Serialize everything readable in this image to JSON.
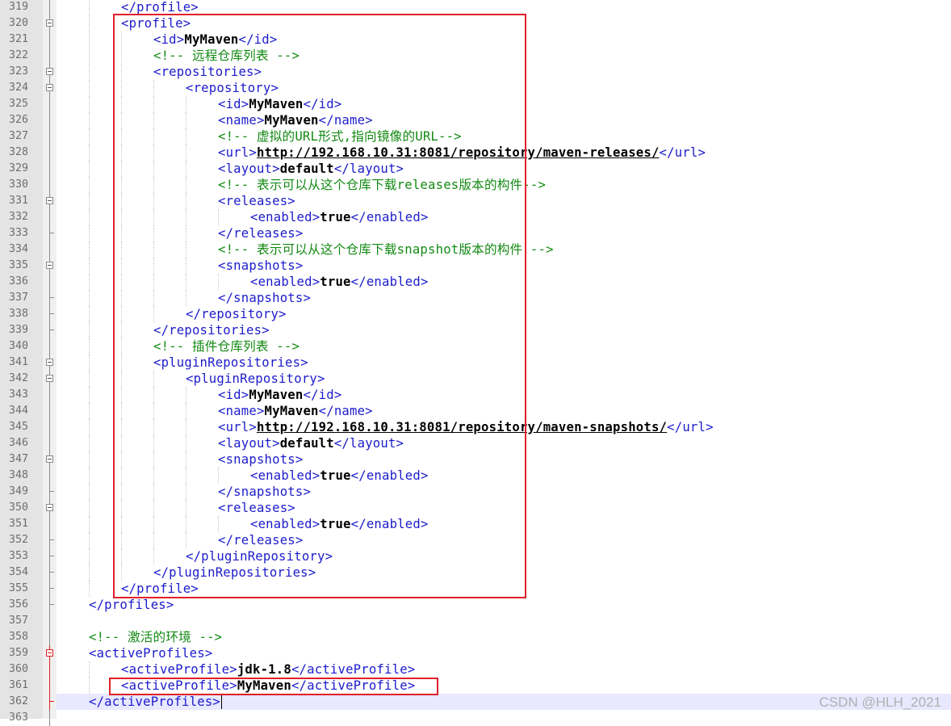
{
  "editor": {
    "current_line": 362,
    "lines": [
      {
        "n": "319",
        "indent": 2,
        "fold": "line",
        "parts": [
          {
            "t": "tag",
            "v": "</profile>"
          }
        ]
      },
      {
        "n": "320",
        "indent": 2,
        "fold": "box",
        "parts": [
          {
            "t": "tag",
            "v": "<profile>"
          }
        ]
      },
      {
        "n": "321",
        "indent": 3,
        "fold": "line",
        "parts": [
          {
            "t": "tag",
            "v": "<id>"
          },
          {
            "t": "text",
            "v": "MyMaven"
          },
          {
            "t": "tag",
            "v": "</id>"
          }
        ]
      },
      {
        "n": "322",
        "indent": 3,
        "fold": "line",
        "parts": [
          {
            "t": "comment",
            "v": "<!-- 远程仓库列表 -->"
          }
        ]
      },
      {
        "n": "323",
        "indent": 3,
        "fold": "box",
        "parts": [
          {
            "t": "tag",
            "v": "<repositories>"
          }
        ]
      },
      {
        "n": "324",
        "indent": 4,
        "fold": "box",
        "parts": [
          {
            "t": "tag",
            "v": "<repository>"
          }
        ]
      },
      {
        "n": "325",
        "indent": 5,
        "fold": "line",
        "parts": [
          {
            "t": "tag",
            "v": "<id>"
          },
          {
            "t": "text",
            "v": "MyMaven"
          },
          {
            "t": "tag",
            "v": "</id>"
          }
        ]
      },
      {
        "n": "326",
        "indent": 5,
        "fold": "line",
        "parts": [
          {
            "t": "tag",
            "v": "<name>"
          },
          {
            "t": "text",
            "v": "MyMaven"
          },
          {
            "t": "tag",
            "v": "</name>"
          }
        ]
      },
      {
        "n": "327",
        "indent": 5,
        "fold": "line",
        "parts": [
          {
            "t": "comment",
            "v": "<!-- 虚拟的URL形式,指向镜像的URL-->"
          }
        ]
      },
      {
        "n": "328",
        "indent": 5,
        "fold": "line",
        "parts": [
          {
            "t": "tag",
            "v": "<url>"
          },
          {
            "t": "url",
            "v": "http://192.168.10.31:8081/repository/maven-releases/"
          },
          {
            "t": "tag",
            "v": "</url>"
          }
        ]
      },
      {
        "n": "329",
        "indent": 5,
        "fold": "line",
        "parts": [
          {
            "t": "tag",
            "v": "<layout>"
          },
          {
            "t": "text",
            "v": "default"
          },
          {
            "t": "tag",
            "v": "</layout>"
          }
        ]
      },
      {
        "n": "330",
        "indent": 5,
        "fold": "line",
        "parts": [
          {
            "t": "comment",
            "v": "<!-- 表示可以从这个仓库下载releases版本的构件-->"
          }
        ]
      },
      {
        "n": "331",
        "indent": 5,
        "fold": "box",
        "parts": [
          {
            "t": "tag",
            "v": "<releases>"
          }
        ]
      },
      {
        "n": "332",
        "indent": 6,
        "fold": "line",
        "parts": [
          {
            "t": "tag",
            "v": "<enabled>"
          },
          {
            "t": "text",
            "v": "true"
          },
          {
            "t": "tag",
            "v": "</enabled>"
          }
        ]
      },
      {
        "n": "333",
        "indent": 5,
        "fold": "end",
        "parts": [
          {
            "t": "tag",
            "v": "</releases>"
          }
        ]
      },
      {
        "n": "334",
        "indent": 5,
        "fold": "line",
        "parts": [
          {
            "t": "comment",
            "v": "<!-- 表示可以从这个仓库下载snapshot版本的构件 -->"
          }
        ]
      },
      {
        "n": "335",
        "indent": 5,
        "fold": "box",
        "parts": [
          {
            "t": "tag",
            "v": "<snapshots>"
          }
        ]
      },
      {
        "n": "336",
        "indent": 6,
        "fold": "line",
        "parts": [
          {
            "t": "tag",
            "v": "<enabled>"
          },
          {
            "t": "text",
            "v": "true"
          },
          {
            "t": "tag",
            "v": "</enabled>"
          }
        ]
      },
      {
        "n": "337",
        "indent": 5,
        "fold": "end",
        "parts": [
          {
            "t": "tag",
            "v": "</snapshots>"
          }
        ]
      },
      {
        "n": "338",
        "indent": 4,
        "fold": "end",
        "parts": [
          {
            "t": "tag",
            "v": "</repository>"
          }
        ]
      },
      {
        "n": "339",
        "indent": 3,
        "fold": "end",
        "parts": [
          {
            "t": "tag",
            "v": "</repositories>"
          }
        ]
      },
      {
        "n": "340",
        "indent": 3,
        "fold": "line",
        "parts": [
          {
            "t": "comment",
            "v": "<!-- 插件仓库列表 -->"
          }
        ]
      },
      {
        "n": "341",
        "indent": 3,
        "fold": "box",
        "parts": [
          {
            "t": "tag",
            "v": "<pluginRepositories>"
          }
        ]
      },
      {
        "n": "342",
        "indent": 4,
        "fold": "box",
        "parts": [
          {
            "t": "tag",
            "v": "<pluginRepository>"
          }
        ]
      },
      {
        "n": "343",
        "indent": 5,
        "fold": "line",
        "parts": [
          {
            "t": "tag",
            "v": "<id>"
          },
          {
            "t": "text",
            "v": "MyMaven"
          },
          {
            "t": "tag",
            "v": "</id>"
          }
        ]
      },
      {
        "n": "344",
        "indent": 5,
        "fold": "line",
        "parts": [
          {
            "t": "tag",
            "v": "<name>"
          },
          {
            "t": "text",
            "v": "MyMaven"
          },
          {
            "t": "tag",
            "v": "</name>"
          }
        ]
      },
      {
        "n": "345",
        "indent": 5,
        "fold": "line",
        "parts": [
          {
            "t": "tag",
            "v": "<url>"
          },
          {
            "t": "url",
            "v": "http://192.168.10.31:8081/repository/maven-snapshots/"
          },
          {
            "t": "tag",
            "v": "</url>"
          }
        ]
      },
      {
        "n": "346",
        "indent": 5,
        "fold": "line",
        "parts": [
          {
            "t": "tag",
            "v": "<layout>"
          },
          {
            "t": "text",
            "v": "default"
          },
          {
            "t": "tag",
            "v": "</layout>"
          }
        ]
      },
      {
        "n": "347",
        "indent": 5,
        "fold": "box",
        "parts": [
          {
            "t": "tag",
            "v": "<snapshots>"
          }
        ]
      },
      {
        "n": "348",
        "indent": 6,
        "fold": "line",
        "parts": [
          {
            "t": "tag",
            "v": "<enabled>"
          },
          {
            "t": "text",
            "v": "true"
          },
          {
            "t": "tag",
            "v": "</enabled>"
          }
        ]
      },
      {
        "n": "349",
        "indent": 5,
        "fold": "end",
        "parts": [
          {
            "t": "tag",
            "v": "</snapshots>"
          }
        ]
      },
      {
        "n": "350",
        "indent": 5,
        "fold": "box",
        "parts": [
          {
            "t": "tag",
            "v": "<releases>"
          }
        ]
      },
      {
        "n": "351",
        "indent": 6,
        "fold": "line",
        "parts": [
          {
            "t": "tag",
            "v": "<enabled>"
          },
          {
            "t": "text",
            "v": "true"
          },
          {
            "t": "tag",
            "v": "</enabled>"
          }
        ]
      },
      {
        "n": "352",
        "indent": 5,
        "fold": "end",
        "parts": [
          {
            "t": "tag",
            "v": "</releases>"
          }
        ]
      },
      {
        "n": "353",
        "indent": 4,
        "fold": "end",
        "parts": [
          {
            "t": "tag",
            "v": "</pluginRepository>"
          }
        ]
      },
      {
        "n": "354",
        "indent": 3,
        "fold": "end",
        "parts": [
          {
            "t": "tag",
            "v": "</pluginRepositories>"
          }
        ]
      },
      {
        "n": "355",
        "indent": 2,
        "fold": "end",
        "parts": [
          {
            "t": "tag",
            "v": "</profile>"
          }
        ]
      },
      {
        "n": "356",
        "indent": 1,
        "fold": "end",
        "parts": [
          {
            "t": "tag",
            "v": "</profiles>"
          }
        ]
      },
      {
        "n": "357",
        "indent": 0,
        "fold": "line",
        "parts": []
      },
      {
        "n": "358",
        "indent": 1,
        "fold": "line",
        "parts": [
          {
            "t": "comment",
            "v": "<!-- 激活的环境 -->"
          }
        ]
      },
      {
        "n": "359",
        "indent": 1,
        "fold": "redbox",
        "parts": [
          {
            "t": "tag",
            "v": "<activeProfiles>"
          }
        ]
      },
      {
        "n": "360",
        "indent": 2,
        "fold": "redline",
        "parts": [
          {
            "t": "tag",
            "v": "<activeProfile>"
          },
          {
            "t": "text",
            "v": "jdk-1.8"
          },
          {
            "t": "tag",
            "v": "</activeProfile>"
          }
        ]
      },
      {
        "n": "361",
        "indent": 2,
        "fold": "redline",
        "parts": [
          {
            "t": "tag",
            "v": "<activeProfile>"
          },
          {
            "t": "text",
            "v": "MyMaven"
          },
          {
            "t": "tag",
            "v": "</activeProfile>"
          }
        ]
      },
      {
        "n": "362",
        "indent": 1,
        "fold": "redend",
        "parts": [
          {
            "t": "tag",
            "v": "</activeProfiles>"
          }
        ],
        "caret": true
      },
      {
        "n": "363",
        "indent": 0,
        "fold": "line",
        "parts": []
      }
    ]
  },
  "watermark": "CSDN @HLH_2021",
  "colors": {
    "tag": "#1c1ccb",
    "comment": "#138a13",
    "highlight_box": "#e0202a"
  }
}
